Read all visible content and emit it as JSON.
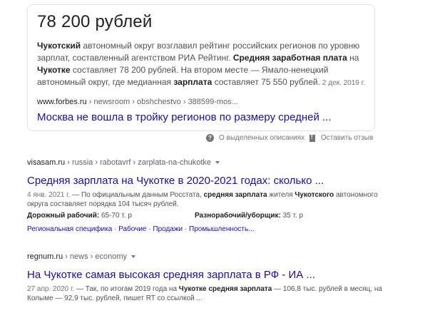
{
  "featured_snippet": {
    "answer": "78 200 рублей",
    "text_parts": [
      "Чукотский",
      " автономный округ возглавил рейтинг российских регионов по уровню зарплат, составленный агентством РИА Рейтинг. ",
      "Средняя заработная плата",
      " на ",
      "Чукотке",
      " составляет 78 200 рублей. На втором месте — Ямало-ненецкий автономный округ, где медианная ",
      "зарплата",
      " составляет 75 550 рублей."
    ],
    "date": "2 дек. 2019 г.",
    "cite_domain": "www.forbes.ru",
    "cite_path": " › newsroom › obshchestvo › 388599-mos...",
    "link_title": "Москва не вошла в тройку регионов по размеру средней ..."
  },
  "feedback": {
    "about_label": "О выделенных описаниях",
    "report_label": "Оставить отзыв"
  },
  "results": [
    {
      "cite_domain": "visasam.ru",
      "cite_path": " › russia › rabotavrf › zarplata-na-chukotke",
      "title": "Средняя зарплата на Чукотке в 2020-2021 годах: сколько ...",
      "date": "4 янв. 2021 г.",
      "desc_parts": [
        " — По официальным данным Росстата, ",
        "средняя зарплата",
        " жителя ",
        "Чукотского",
        " автономного округа составляет порядка 104 тысяч рублей."
      ],
      "salary": [
        {
          "label": "Дорожный рабочий:",
          "value": " 65-70 т. р"
        },
        {
          "label": "Разнорабочий/уборщик:",
          "value": " 35 т. р"
        }
      ],
      "sitelinks": [
        "Региональная специфика",
        "Рабочие",
        "Продажи",
        "Промышленность..."
      ]
    },
    {
      "cite_domain": "regnum.ru",
      "cite_path": " › news › economy",
      "title": "На Чукотке самая высокая средняя зарплата в РФ - ИА ...",
      "date": "27 апр. 2020 г.",
      "desc_parts": [
        " — Так, по итогам 2019 года на ",
        "Чукотке средняя зарплата",
        " — 106,8 тыс. рублей в месяц, на Колыме — 92,9 тыс. рублей, пишет RT со ссылкой ..."
      ]
    }
  ]
}
